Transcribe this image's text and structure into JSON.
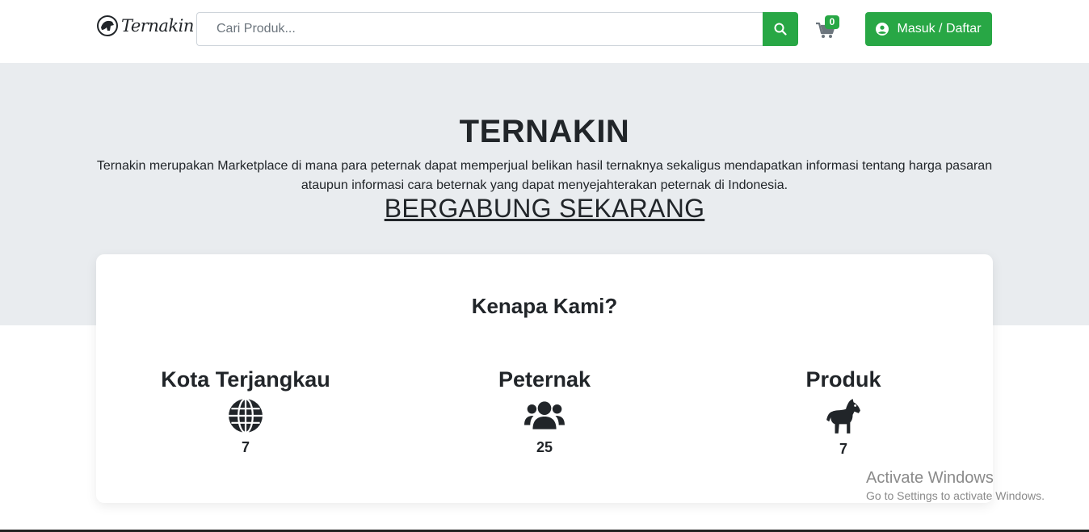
{
  "navbar": {
    "logo_text": "Ternakin",
    "search_placeholder": "Cari Produk...",
    "cart_count": "0",
    "login_label": "Masuk / Daftar"
  },
  "hero": {
    "title": "TERNAKIN",
    "description": "Ternakin merupakan Marketplace di mana para peternak dapat memperjual belikan hasil ternaknya sekaligus mendapatkan informasi tentang harga pasaran ataupun informasi cara beternak yang dapat menyejahterakan peternak di Indonesia.",
    "cta": "BERGABUNG SEKARANG"
  },
  "why": {
    "title": "Kenapa Kami?",
    "stats": [
      {
        "label": "Kota Terjangkau",
        "icon": "globe-icon",
        "value": "7"
      },
      {
        "label": "Peternak",
        "icon": "users-icon",
        "value": "25"
      },
      {
        "label": "Produk",
        "icon": "horse-icon",
        "value": "7"
      }
    ]
  },
  "watermark": {
    "title": "Activate Windows",
    "subtitle": "Go to Settings to activate Windows."
  },
  "colors": {
    "accent": "#28a745",
    "hero_bg": "#e9ecef",
    "text": "#212529"
  }
}
